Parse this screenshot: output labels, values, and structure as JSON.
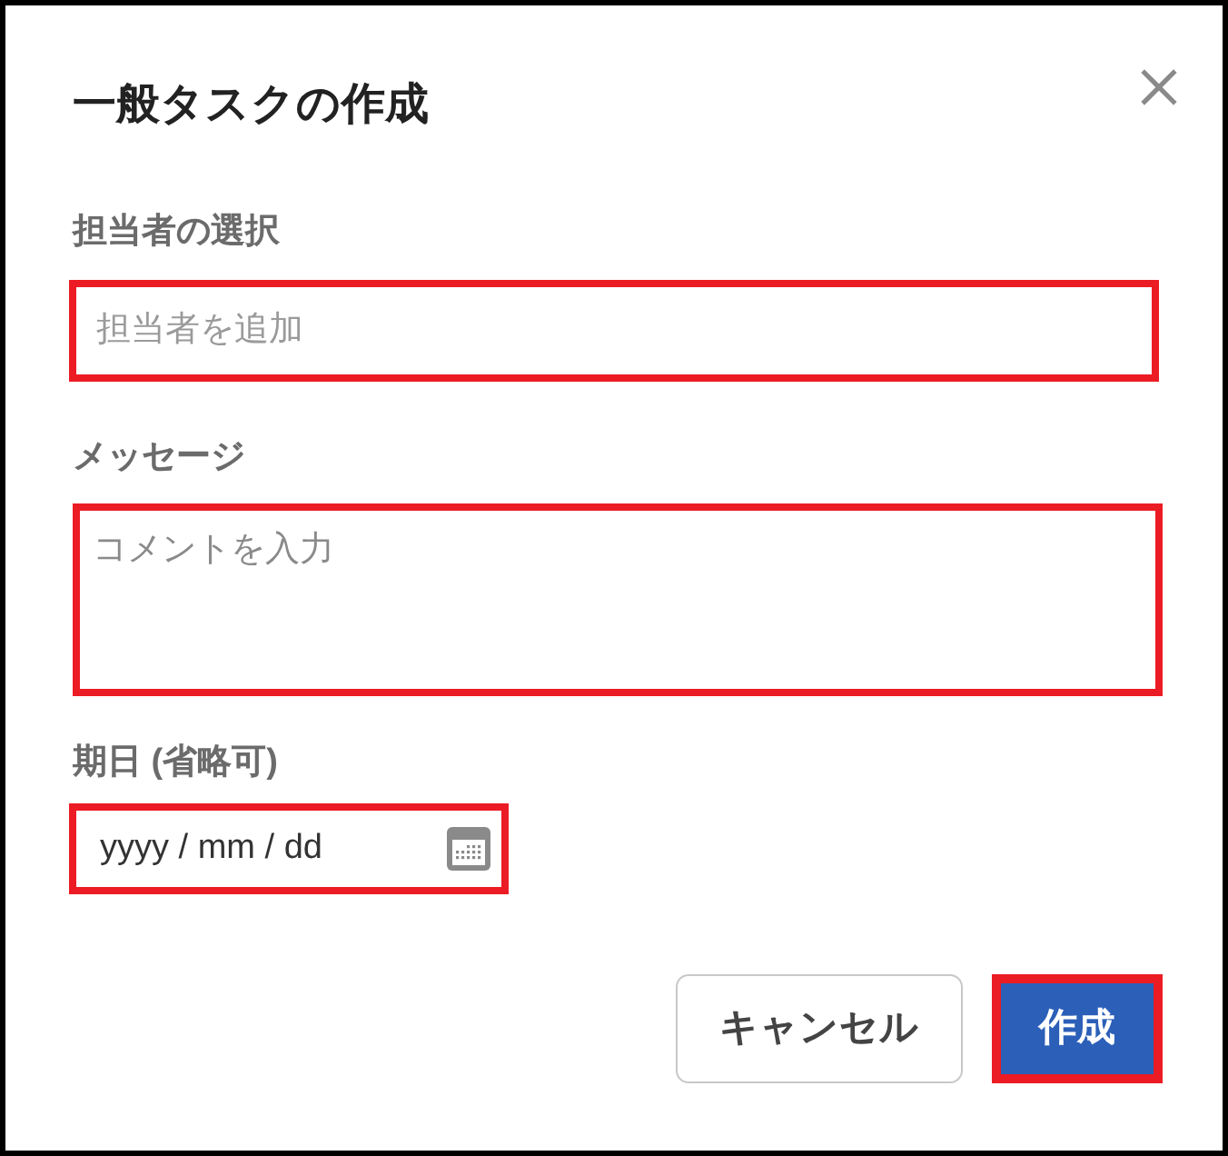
{
  "dialog": {
    "title": "一般タスクの作成"
  },
  "fields": [
    {
      "kind": "text",
      "label": "担当者の選択",
      "placeholder": "担当者を追加",
      "highlighted": true
    },
    {
      "kind": "textarea",
      "label": "メッセージ",
      "placeholder": "コメントを入力",
      "highlighted": true
    },
    {
      "kind": "date",
      "label": "期日 (省略可)",
      "placeholder": "yyyy / mm / dd",
      "highlighted": true
    }
  ],
  "buttons": [
    {
      "kind": "secondary",
      "label": "キャンセル",
      "highlighted": false
    },
    {
      "kind": "primary",
      "label": "作成",
      "highlighted": true
    }
  ]
}
